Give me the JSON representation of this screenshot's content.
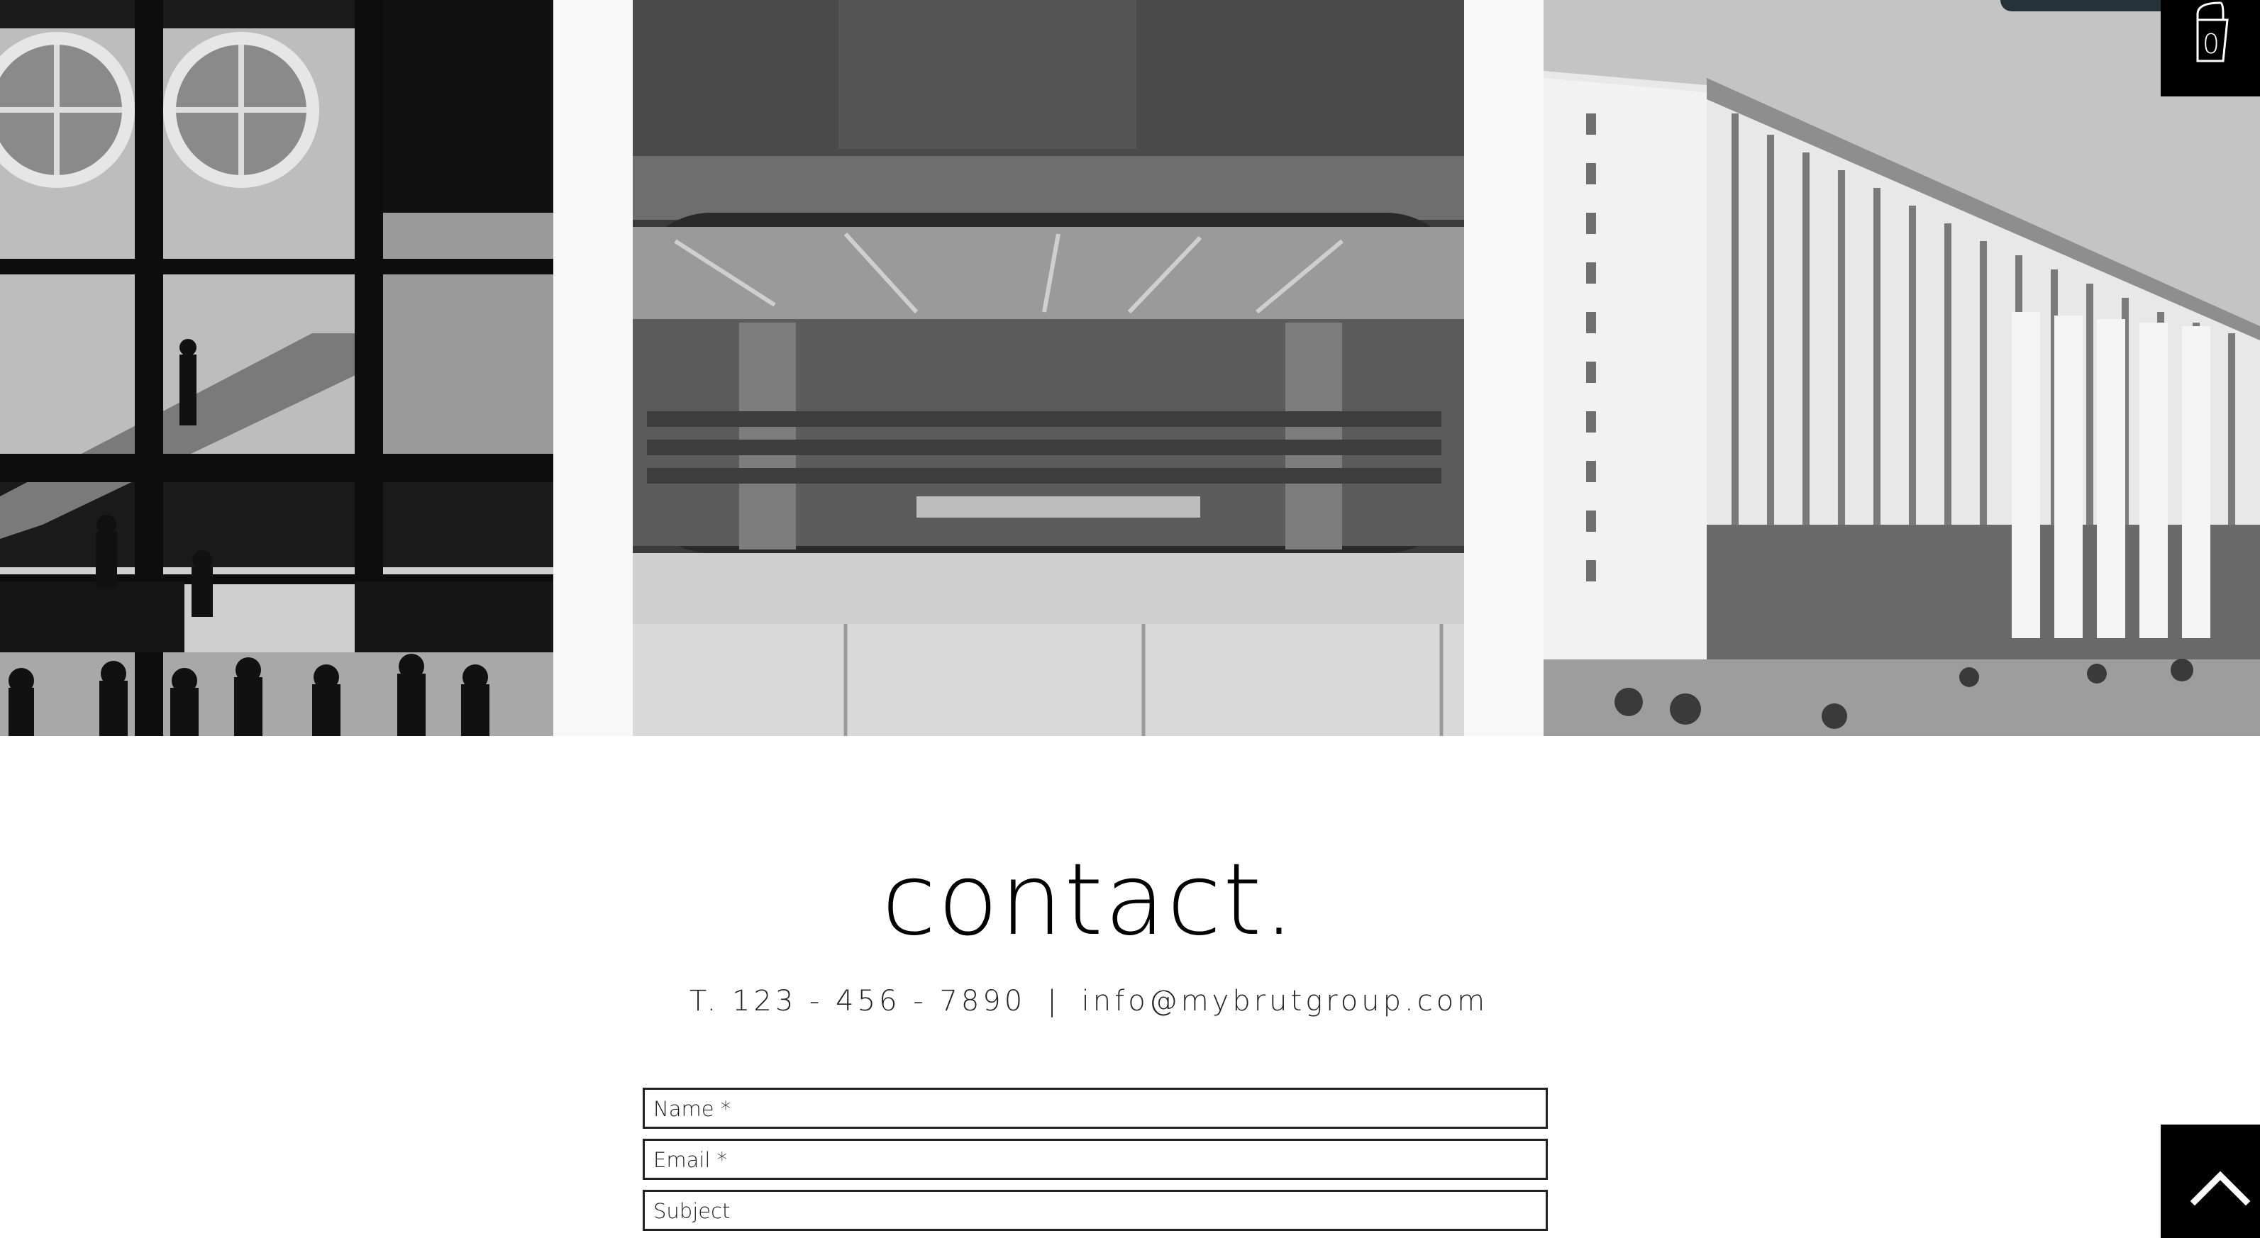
{
  "gallery": {
    "images": [
      {
        "name": "atrium-photo"
      },
      {
        "name": "library-window-photo"
      },
      {
        "name": "curved-building-photo"
      }
    ]
  },
  "cart": {
    "count": "0",
    "icon": "shopping-bag-icon"
  },
  "contact": {
    "title": "contact.",
    "phone": "T. 123 - 456 - 7890",
    "separator": "|",
    "email": "info@mybrutgroup.com"
  },
  "form": {
    "name_placeholder": "Name *",
    "email_placeholder": "Email *",
    "subject_placeholder": "Subject"
  },
  "back_to_top": {
    "icon": "chevron-up-icon"
  },
  "colors": {
    "background": "#ffffff",
    "text": "#000000",
    "button_bg": "#000000"
  }
}
